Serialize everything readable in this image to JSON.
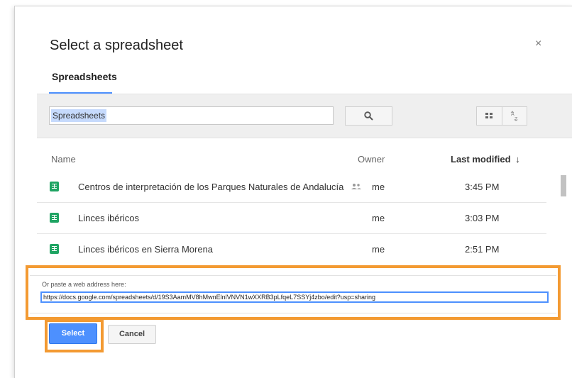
{
  "dialog": {
    "title": "Select a spreadsheet",
    "close_label": "×",
    "tab_label": "Spreadsheets"
  },
  "toolbar": {
    "search_value": "Spreadsheets",
    "search_icon": "search-icon",
    "view_icon": "grid-view-icon",
    "sort_icon": "sort-az-icon",
    "sort_text": "A Z"
  },
  "columns": {
    "name": "Name",
    "owner": "Owner",
    "modified": "Last modified",
    "modified_arrow": "↓"
  },
  "files": [
    {
      "name": "Centros de interpretación de los Parques Naturales de Andalucía",
      "owner": "me",
      "modified": "3:45 PM",
      "shared": true
    },
    {
      "name": "Linces ibéricos",
      "owner": "me",
      "modified": "3:03 PM",
      "shared": false
    },
    {
      "name": "Linces ibéricos en Sierra Morena",
      "owner": "me",
      "modified": "2:51 PM",
      "shared": false
    }
  ],
  "paste": {
    "label": "Or paste a web address here:",
    "url": "https://docs.google.com/spreadsheets/d/19S3AamMV8hMwnElnlVNVN1wXXRB3pLfqeL7SSYj4zbo/edit?usp=sharing"
  },
  "buttons": {
    "select": "Select",
    "cancel": "Cancel"
  },
  "colors": {
    "accent": "#4d90fe",
    "highlight": "#f39a32",
    "sheet_green": "#1fa463"
  }
}
